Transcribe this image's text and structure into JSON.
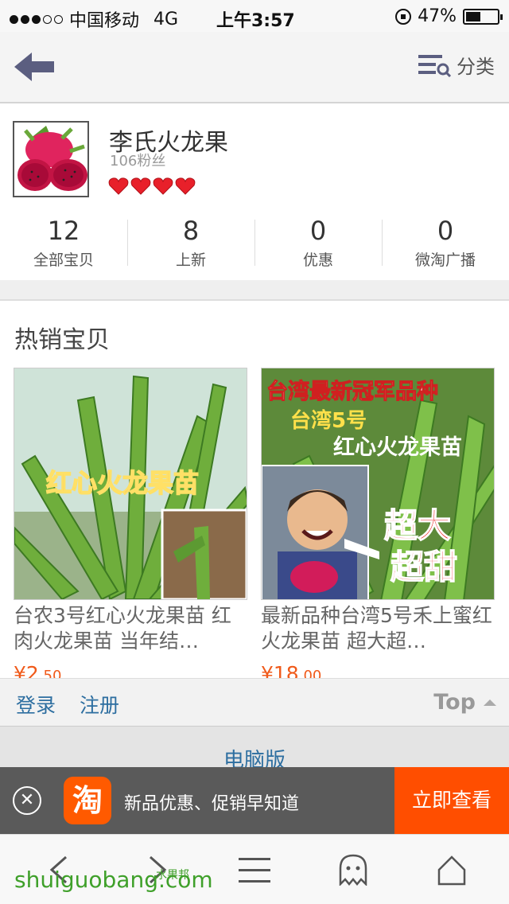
{
  "status_bar": {
    "carrier": "中国移动",
    "network": "4G",
    "time": "上午3:57",
    "battery": "47%",
    "battery_level": 0.47
  },
  "nav": {
    "back_icon": "back-arrow-icon",
    "category_label": "分类",
    "category_icon": "list-search-icon"
  },
  "shop": {
    "name": "李氏火龙果",
    "fans": "106粉丝",
    "hearts": 4,
    "stats": [
      {
        "value": "12",
        "label": "全部宝贝"
      },
      {
        "value": "8",
        "label": "上新"
      },
      {
        "value": "0",
        "label": "优惠"
      },
      {
        "value": "0",
        "label": "微淘广播"
      }
    ]
  },
  "hot": {
    "title": "热销宝贝",
    "products": [
      {
        "image_caption": "红心火龙果苗",
        "title": "台农3号红心火龙果苗 红肉火龙果苗 当年结…",
        "price_main": "¥2",
        "price_decimal": ".50"
      },
      {
        "image_caption_1": "台湾最新冠军品种",
        "image_caption_2": "台湾5号",
        "image_caption_3": "红心火龙果苗",
        "image_caption_4": "超大",
        "image_caption_5": "超甜",
        "title": "最新品种台湾5号禾上蜜红火龙果苗 超大超…",
        "price_main": "¥18",
        "price_decimal": ".00"
      }
    ]
  },
  "footer": {
    "login": "登录",
    "register": "注册",
    "top": "Top",
    "pc_version": "电脑版"
  },
  "banner": {
    "logo_char": "淘",
    "text": "新品优惠、促销早知道",
    "cta": "立即查看",
    "close_symbol": "✕"
  },
  "toolbar": {
    "watermark": "shuiguobang.com",
    "watermark_cn": "水果邦"
  },
  "colors": {
    "accent_orange": "#ff4e00",
    "link_blue": "#2d6ea0",
    "price_orange": "#f05a1a",
    "heart_red": "#e8202a"
  }
}
